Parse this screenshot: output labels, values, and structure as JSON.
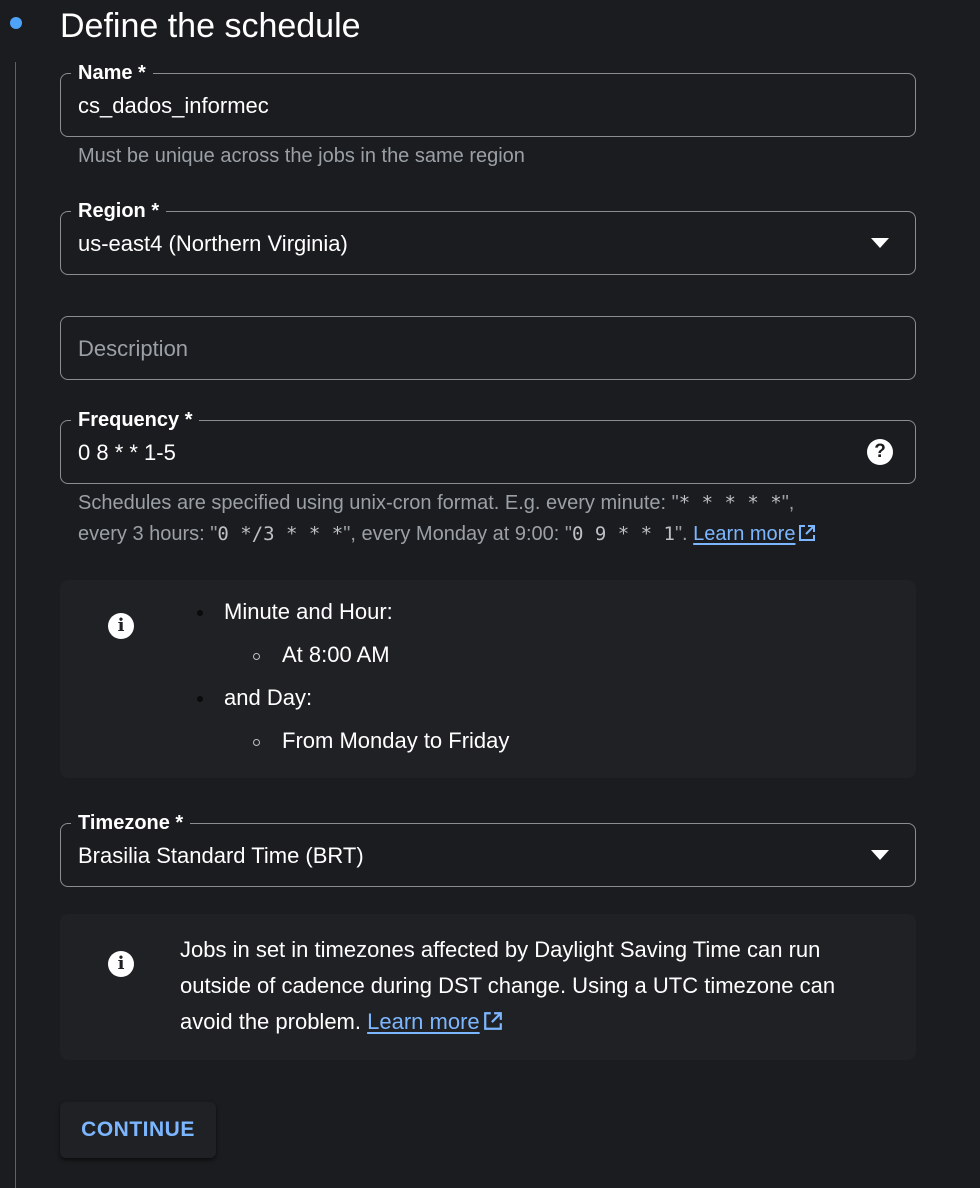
{
  "step": {
    "title": "Define the schedule"
  },
  "name_field": {
    "label": "Name *",
    "value": "cs_dados_informec",
    "hint": "Must be unique across the jobs in the same region"
  },
  "region_field": {
    "label": "Region *",
    "value": "us-east4 (Northern Virginia)"
  },
  "description_field": {
    "placeholder": "Description"
  },
  "frequency_field": {
    "label": "Frequency *",
    "value": "0 8 * * 1-5",
    "help_icon": "?",
    "hint": {
      "part1": "Schedules are specified using unix-cron format. E.g. every minute: \"",
      "ex1": "* * * * *",
      "part2": "\",",
      "part3": "every 3 hours: \"",
      "ex2": "0 */3 * * *",
      "part4": "\", every Monday at 9:00: \"",
      "ex3": "0 9 * * 1",
      "part5": "\".",
      "learn_more": "Learn more"
    }
  },
  "cron_description": {
    "minute_hour_label": "Minute and Hour:",
    "minute_hour_value": "At 8:00 AM",
    "day_label": "and Day:",
    "day_value": "From Monday to Friday"
  },
  "timezone_field": {
    "label": "Timezone *",
    "value": "Brasilia Standard Time (BRT)"
  },
  "dst_notice": {
    "text": "Jobs in set in timezones affected by Daylight Saving Time can run outside of cadence during DST change. Using a UTC timezone can avoid the problem.",
    "learn_more": "Learn more"
  },
  "actions": {
    "continue_label": "CONTINUE"
  },
  "icons": {
    "info": "info-icon",
    "help": "help-icon",
    "dropdown": "chevron-down-icon",
    "external": "external-link-icon"
  },
  "colors": {
    "background": "#1b1c1f",
    "panel": "#202124",
    "accent": "#7cb6ff",
    "step_dot": "#4fa3f7"
  }
}
